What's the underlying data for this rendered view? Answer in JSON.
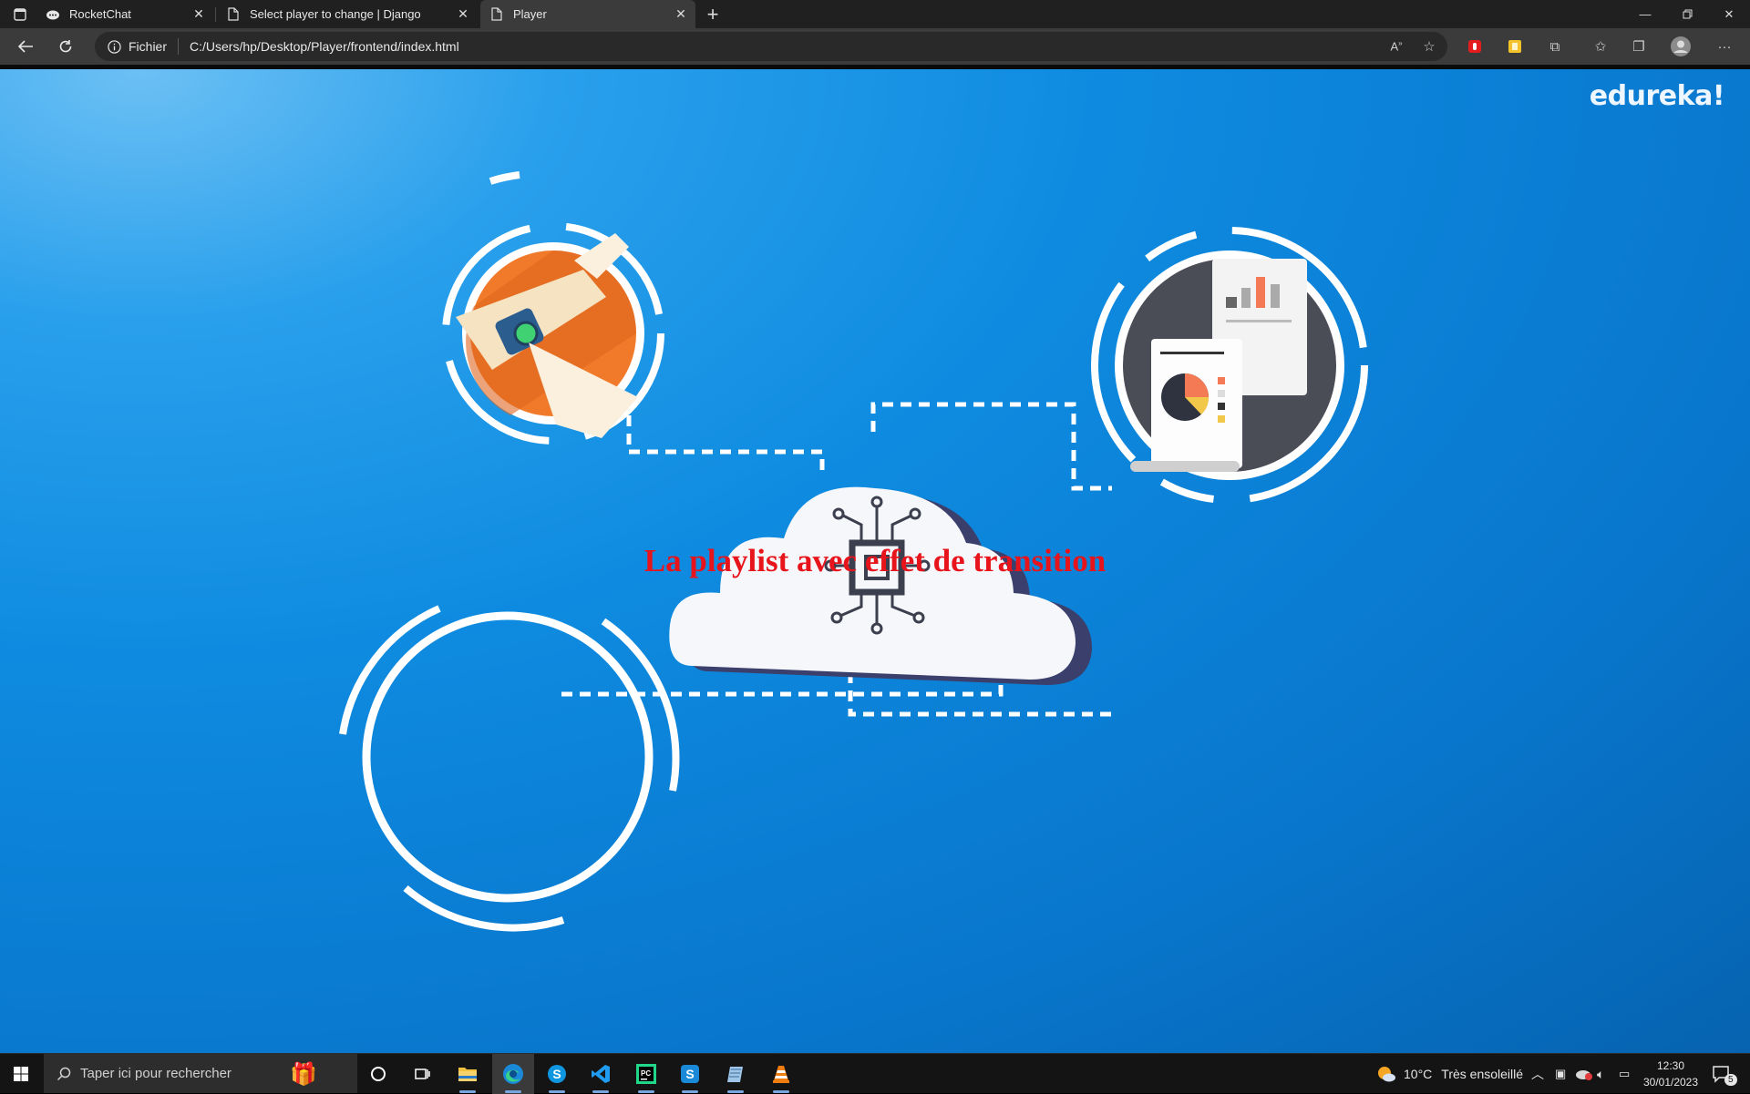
{
  "browser": {
    "tabs": [
      {
        "title": "RocketChat",
        "icon": "rocketchat-icon"
      },
      {
        "title": "Select player to change | Django",
        "icon": "page-icon"
      },
      {
        "title": "Player",
        "icon": "page-icon",
        "active": true
      }
    ],
    "address": {
      "scheme_label": "Fichier",
      "url": "C:/Users/hp/Desktop/Player/frontend/index.html"
    }
  },
  "page": {
    "brand": "edureka!",
    "headline": "La playlist avec effet de transition",
    "colors": {
      "background": "#0e8be0",
      "headline": "#e8141c"
    }
  },
  "taskbar": {
    "search_placeholder": "Taper ici pour rechercher",
    "weather": {
      "temp": "10°C",
      "condition": "Très ensoleillé"
    },
    "clock": {
      "time": "12:30",
      "date": "30/01/2023"
    },
    "notification_count": "5"
  }
}
